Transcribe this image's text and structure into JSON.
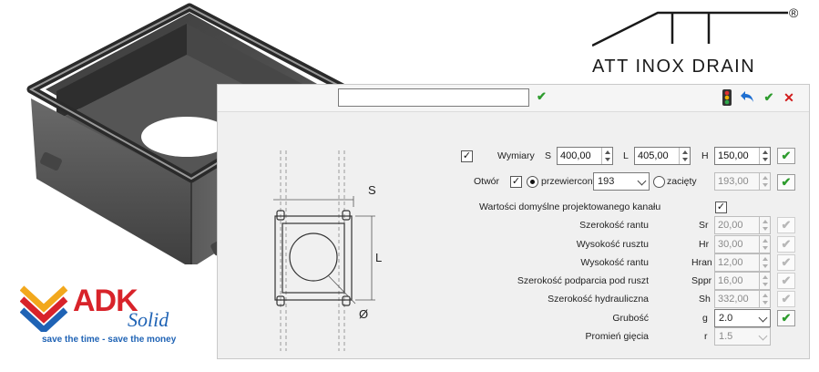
{
  "brand": {
    "name": "ATT INOX DRAIN",
    "reg": "®"
  },
  "adk": {
    "name": "ADK",
    "sub": "Solid",
    "tagline": "save the time - save the money"
  },
  "dialog": {
    "name_value": "",
    "dims": {
      "label": "Wymiary",
      "s_label": "S",
      "s_value": "400,00",
      "l_label": "L",
      "l_value": "405,00",
      "h_label": "H",
      "h_value": "150,00"
    },
    "hole": {
      "label": "Otwór",
      "opt1": "przewiercony",
      "opt1_value": "193",
      "opt2": "zacięty",
      "opt2_value": "193,00"
    },
    "defaults_label": "Wartości domyślne projektowanego kanału",
    "params": [
      {
        "label": "Szerokość rantu",
        "code": "Sr",
        "value": "20,00"
      },
      {
        "label": "Wysokość rusztu",
        "code": "Hr",
        "value": "30,00"
      },
      {
        "label": "Wysokość rantu",
        "code": "Hran",
        "value": "12,00"
      },
      {
        "label": "Szerokość podparcia pod ruszt",
        "code": "Sppr",
        "value": "16,00"
      },
      {
        "label": "Szerokość hydrauliczna",
        "code": "Sh",
        "value": "332,00"
      }
    ],
    "thickness": {
      "label": "Grubość",
      "code": "g",
      "value": "2.0"
    },
    "bend": {
      "label": "Promień gięcia",
      "code": "r",
      "value": "1.5"
    }
  },
  "drawing": {
    "s": "S",
    "l": "L",
    "d": "Ø"
  },
  "colors": {
    "ok_green": "#2e9c2e",
    "cancel_red": "#d11b1b",
    "undo_blue": "#1f6fd1",
    "adk_red": "#d8232a",
    "adk_blue": "#1f63b5"
  }
}
